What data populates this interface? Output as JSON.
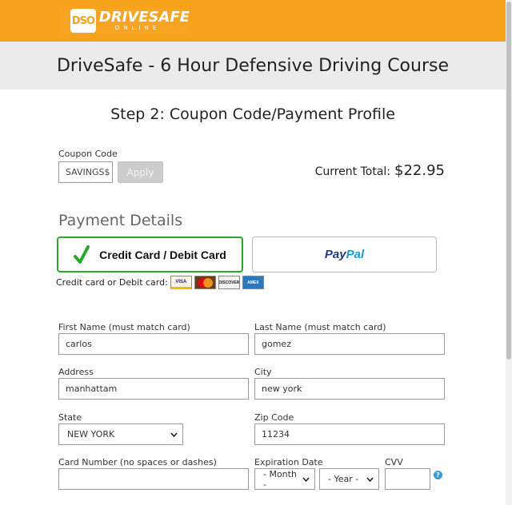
{
  "brand": {
    "logo_mark": "DSO",
    "logo_word": "DRIVESAFE",
    "logo_sub": "ONLINE",
    "accent_color": "#f7a21b"
  },
  "header": {
    "title": "DriveSafe - 6 Hour Defensive Driving Course"
  },
  "step": {
    "title": "Step 2: Coupon Code/Payment Profile"
  },
  "coupon": {
    "label": "Coupon Code",
    "value": "SAVINGS$",
    "apply_label": "Apply"
  },
  "total": {
    "label": "Current Total:",
    "value": "$22.95"
  },
  "payment": {
    "section_title": "Payment Details",
    "credit_option_label": "Credit Card / Debit Card",
    "paypal_pay": "Pay",
    "paypal_pal": "Pal",
    "cards_text": "Credit card or Debit card:",
    "card_logos": {
      "visa": "VISA",
      "discover": "DISCOVER",
      "amex": "AMEX"
    },
    "selected_color": "#2aa72a"
  },
  "form": {
    "first_name": {
      "label": "First Name (must match card)",
      "value": "carlos"
    },
    "last_name": {
      "label": "Last Name (must match card)",
      "value": "gomez"
    },
    "address": {
      "label": "Address",
      "value": "manhattam"
    },
    "city": {
      "label": "City",
      "value": "new york"
    },
    "state": {
      "label": "State",
      "value": "NEW YORK"
    },
    "zip": {
      "label": "Zip Code",
      "value": "11234"
    },
    "card_number": {
      "label": "Card Number (no spaces or dashes)",
      "value": ""
    },
    "expiration": {
      "label": "Expiration Date",
      "month": "- Month -",
      "year": "- Year -"
    },
    "cvv": {
      "label": "CVV",
      "value": "",
      "help": "?"
    }
  }
}
